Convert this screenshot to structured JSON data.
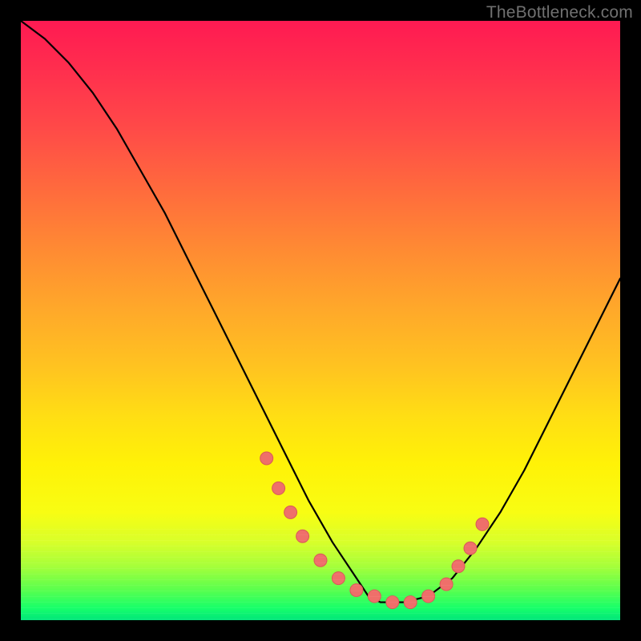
{
  "watermark": "TheBottleneck.com",
  "colors": {
    "frame_bg": "#000000",
    "watermark": "#707070",
    "curve": "#000000",
    "dot_fill": "#ef6f6a",
    "dot_stroke": "#d85a56"
  },
  "chart_data": {
    "type": "line",
    "title": "",
    "xlabel": "",
    "ylabel": "",
    "xlim": [
      0,
      100
    ],
    "ylim": [
      0,
      100
    ],
    "note": "Units are percent of plot area. y=0 at bottom (green), y=100 at top (red). The curve is a V-shaped mismatch/bottleneck curve with its minimum near x≈58 where it nearly touches the bottom.",
    "series": [
      {
        "name": "bottleneck-curve",
        "x": [
          0,
          4,
          8,
          12,
          16,
          20,
          24,
          28,
          32,
          36,
          40,
          44,
          48,
          52,
          56,
          58,
          60,
          64,
          68,
          72,
          76,
          80,
          84,
          88,
          92,
          96,
          100
        ],
        "y": [
          100,
          97,
          93,
          88,
          82,
          75,
          68,
          60,
          52,
          44,
          36,
          28,
          20,
          13,
          7,
          4,
          3,
          3,
          4,
          7,
          12,
          18,
          25,
          33,
          41,
          49,
          57
        ]
      },
      {
        "name": "sample-dots",
        "x": [
          41,
          43,
          45,
          47,
          50,
          53,
          56,
          59,
          62,
          65,
          68,
          71,
          73,
          75,
          77
        ],
        "y": [
          27,
          22,
          18,
          14,
          10,
          7,
          5,
          4,
          3,
          3,
          4,
          6,
          9,
          12,
          16
        ]
      }
    ]
  }
}
